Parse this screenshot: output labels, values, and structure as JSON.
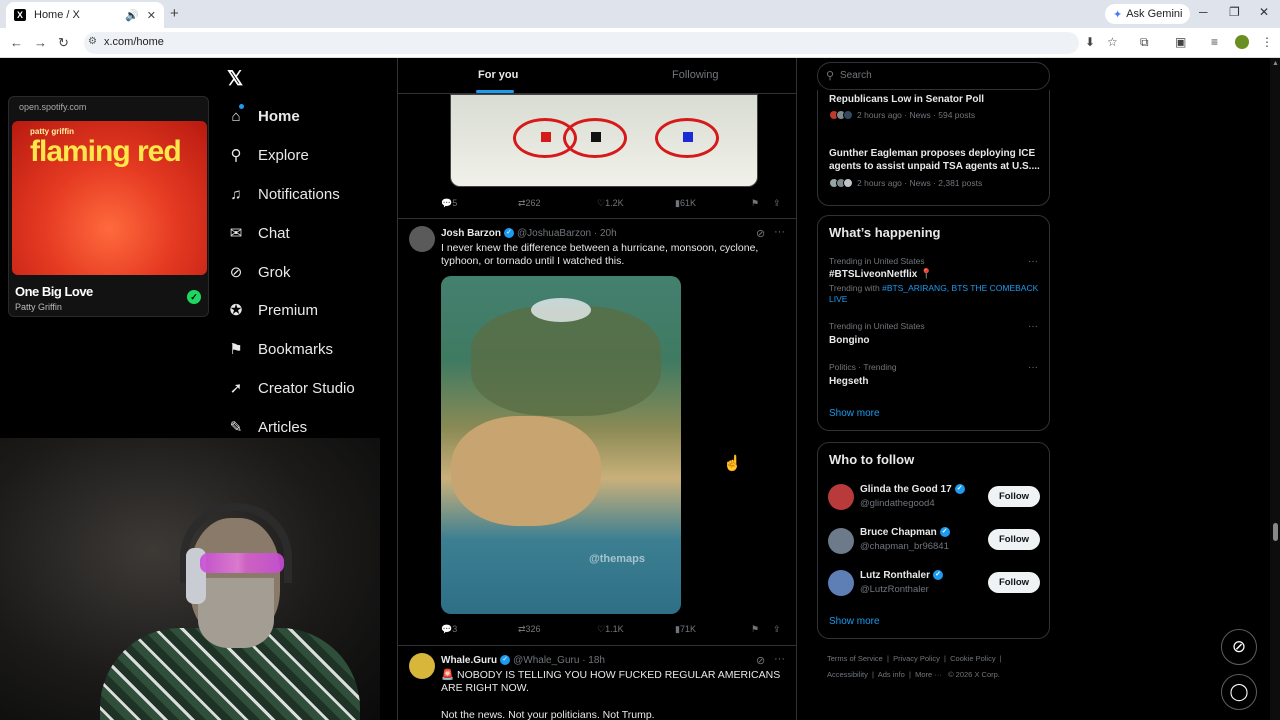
{
  "browser": {
    "tab_title": "Home / X",
    "url": "x.com/home",
    "ask_gemini": "Ask Gemini"
  },
  "spotify": {
    "source": "open.spotify.com",
    "album_artist": "patty griffin",
    "album_title": "flaming red",
    "song": "One Big Love",
    "artist": "Patty Griffin"
  },
  "nav": {
    "items": [
      {
        "label": "Home",
        "icon": "home-icon"
      },
      {
        "label": "Explore",
        "icon": "search-icon"
      },
      {
        "label": "Notifications",
        "icon": "bell-icon"
      },
      {
        "label": "Chat",
        "icon": "mail-icon"
      },
      {
        "label": "Grok",
        "icon": "grok-icon"
      },
      {
        "label": "Premium",
        "icon": "verified-icon"
      },
      {
        "label": "Bookmarks",
        "icon": "bookmark-icon"
      },
      {
        "label": "Creator Studio",
        "icon": "rocket-icon"
      },
      {
        "label": "Articles",
        "icon": "article-icon"
      }
    ]
  },
  "timeline": {
    "tabs": [
      "For you",
      "Following"
    ],
    "post1_actions": {
      "replies": "5",
      "reposts": "262",
      "likes": "1.2K",
      "views": "61K"
    },
    "post2": {
      "name": "Josh Barzon",
      "handle": "@JoshuaBarzon",
      "time": "· 20h",
      "text": "I never knew the difference between a hurricane, monsoon, cyclone, typhoon, or tornado until I watched this.",
      "watermark": "@themaps",
      "actions": {
        "replies": "3",
        "reposts": "326",
        "likes": "1.1K",
        "views": "71K"
      }
    },
    "post3": {
      "name": "Whale.Guru",
      "handle": "@Whale_Guru",
      "time": "· 18h",
      "text": "🚨 NOBODY IS TELLING YOU HOW FUCKED REGULAR AMERICANS ARE RIGHT NOW.",
      "text2": "Not the news. Not your politicians. Not Trump."
    }
  },
  "right": {
    "search_placeholder": "Search",
    "news": [
      {
        "title": "Republicans Low in Senator Poll",
        "meta": "2 hours ago · News · 594 posts"
      },
      {
        "title": "Gunther Eagleman proposes deploying ICE agents to assist unpaid TSA agents at U.S....",
        "meta": "2 hours ago · News · 2,381 posts"
      }
    ],
    "whats_happening": {
      "title": "What’s happening",
      "trends": [
        {
          "category": "Trending in United States",
          "name": "#BTSLiveonNetflix 📍",
          "with_prefix": "Trending with",
          "with": "#BTS_ARIRANG, BTS THE COMEBACK LIVE"
        },
        {
          "category": "Trending in United States",
          "name": "Bongino"
        },
        {
          "category": "Politics · Trending",
          "name": "Hegseth"
        }
      ],
      "show_more": "Show more"
    },
    "who_to_follow": {
      "title": "Who to follow",
      "users": [
        {
          "name": "Glinda the Good 17",
          "handle": "@glindathegood4",
          "button": "Follow"
        },
        {
          "name": "Bruce Chapman",
          "handle": "@chapman_br96841",
          "button": "Follow"
        },
        {
          "name": "Lutz Ronthaler",
          "handle": "@LutzRonthaler",
          "button": "Follow"
        }
      ],
      "show_more": "Show more"
    },
    "footer": {
      "line1": [
        "Terms of Service",
        "Privacy Policy",
        "Cookie Policy"
      ],
      "line2": [
        "Accessibility",
        "Ads info",
        "More ···",
        "© 2026 X Corp."
      ]
    }
  },
  "colors": {
    "accent": "#1d9bf0",
    "background": "#000000",
    "border": "#2f3336",
    "muted": "#71767b"
  }
}
